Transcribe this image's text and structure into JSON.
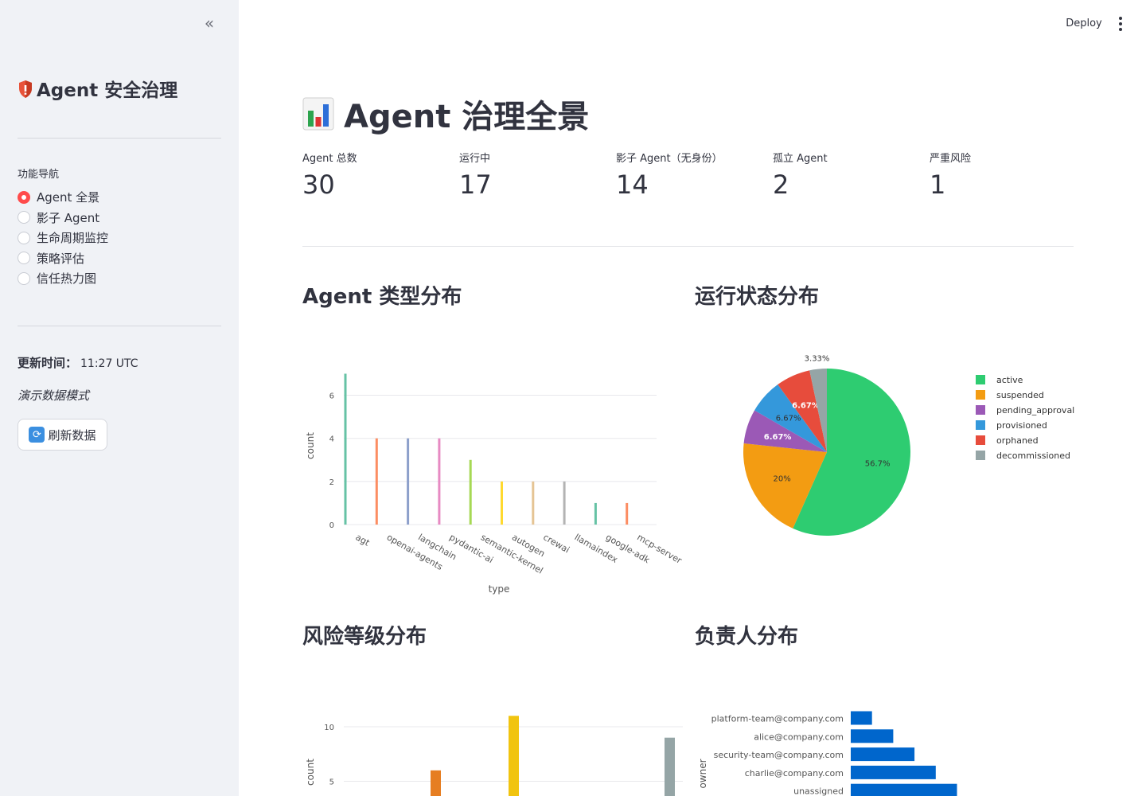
{
  "sidebar": {
    "collapse_icon": "chevrons-left-icon",
    "title": "Agent 安全治理",
    "nav_label": "功能导航",
    "nav_items": [
      {
        "label": "Agent 全景",
        "selected": true
      },
      {
        "label": "影子 Agent",
        "selected": false
      },
      {
        "label": "生命周期监控",
        "selected": false
      },
      {
        "label": "策略评估",
        "selected": false
      },
      {
        "label": "信任热力图",
        "selected": false
      }
    ],
    "update_label": "更新时间：",
    "update_time": "11:27 UTC",
    "demo_mode": "演示数据模式",
    "refresh_label": "刷新数据"
  },
  "toolbar": {
    "deploy_label": "Deploy"
  },
  "main": {
    "title": "Agent 治理全景",
    "metrics": [
      {
        "label": "Agent 总数",
        "value": "30"
      },
      {
        "label": "运行中",
        "value": "17"
      },
      {
        "label": "影子 Agent（无身份）",
        "value": "14"
      },
      {
        "label": "孤立 Agent",
        "value": "2"
      },
      {
        "label": "严重风险",
        "value": "1"
      }
    ],
    "sections": {
      "type_dist": "Agent 类型分布",
      "status_dist": "运行状态分布",
      "risk_dist": "风险等级分布",
      "owner_dist": "负责人分布"
    }
  },
  "chart_data": [
    {
      "type": "bar",
      "xlabel": "type",
      "ylabel": "count",
      "categories": [
        "agt",
        "openai-agents",
        "langchain",
        "pydantic-ai",
        "semantic-kernel",
        "autogen",
        "crewai",
        "llamaindex",
        "google-adk",
        "mcp-server"
      ],
      "values": [
        7,
        4,
        4,
        4,
        3,
        2,
        2,
        2,
        1,
        1
      ],
      "colors": [
        "#66c2a5",
        "#fc8d62",
        "#8da0cb",
        "#e78ac3",
        "#a6d854",
        "#ffd92f",
        "#e5c494",
        "#b3b3b3",
        "#66c2a5",
        "#fc8d62"
      ],
      "yticks": [
        0,
        2,
        4,
        6
      ],
      "ylim": [
        0,
        7.35
      ]
    },
    {
      "type": "pie",
      "labels": [
        "active",
        "suspended",
        "pending_approval",
        "provisioned",
        "orphaned",
        "decommissioned"
      ],
      "values": [
        17,
        6,
        2,
        2,
        2,
        1
      ],
      "percent_labels": [
        "56.7%",
        "20%",
        "6.67%",
        "6.67%",
        "6.67%",
        "3.33%"
      ],
      "colors": [
        "#2ecc71",
        "#f39c12",
        "#9b59b6",
        "#3498db",
        "#e74c3c",
        "#95a5a6"
      ],
      "legend": "right"
    },
    {
      "type": "bar",
      "ylabel": "count",
      "values": [
        6,
        11,
        9
      ],
      "colors": [
        "#e67e22",
        "#f1c40f",
        "#95a5a6"
      ],
      "yticks": [
        5,
        10
      ]
    },
    {
      "type": "bar",
      "orientation": "horizontal",
      "ylabel": "owner",
      "categories": [
        "platform-team@company.com",
        "alice@company.com",
        "security-team@company.com",
        "charlie@company.com",
        "unassigned"
      ],
      "values": [
        1,
        2,
        3,
        4,
        5
      ],
      "color": "#0066cc"
    }
  ]
}
